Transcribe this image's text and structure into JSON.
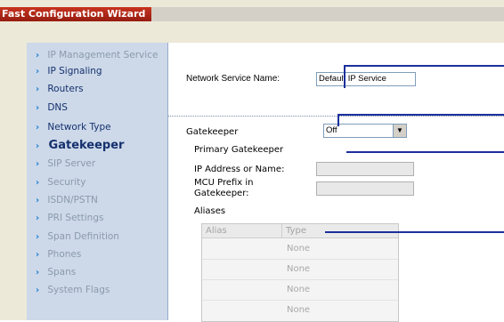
{
  "window": {
    "title": "Fast Configuration Wizard"
  },
  "sidebar": {
    "items": [
      {
        "label": "IP Management Service",
        "state": "disabled"
      },
      {
        "label": "IP Signaling",
        "state": "enabled"
      },
      {
        "label": "Routers",
        "state": "enabled"
      },
      {
        "label": "DNS",
        "state": "enabled"
      },
      {
        "label": "Network Type",
        "state": "enabled"
      },
      {
        "label": "Gatekeeper",
        "state": "active"
      },
      {
        "label": "SIP Server",
        "state": "disabled"
      },
      {
        "label": "Security",
        "state": "disabled"
      },
      {
        "label": "ISDN/PSTN",
        "state": "disabled"
      },
      {
        "label": "PRI Settings",
        "state": "disabled"
      },
      {
        "label": "Span Definition",
        "state": "disabled"
      },
      {
        "label": "Phones",
        "state": "disabled"
      },
      {
        "label": "Spans",
        "state": "disabled"
      },
      {
        "label": "System Flags",
        "state": "disabled"
      }
    ]
  },
  "main": {
    "network_service_label": "Network Service Name:",
    "network_service_value": "Default IP Service",
    "gatekeeper_label": "Gatekeeper",
    "gatekeeper_value": "Off",
    "primary_gatekeeper_label": "Primary Gatekeeper",
    "ip_address_label": "IP Address or Name:",
    "mcu_prefix_label_line1": "MCU Prefix in",
    "mcu_prefix_label_line2": "Gatekeeper:",
    "aliases_label": "Aliases",
    "aliases_table": {
      "columns": [
        "Alias",
        "Type"
      ],
      "rows": [
        {
          "type": "None"
        },
        {
          "type": "None"
        },
        {
          "type": "None"
        },
        {
          "type": "None"
        }
      ]
    }
  },
  "colors": {
    "title_bar": "#b52a1a",
    "sidebar_bg": "#cdd9e9",
    "callout_lines": "#1b2f9c"
  }
}
